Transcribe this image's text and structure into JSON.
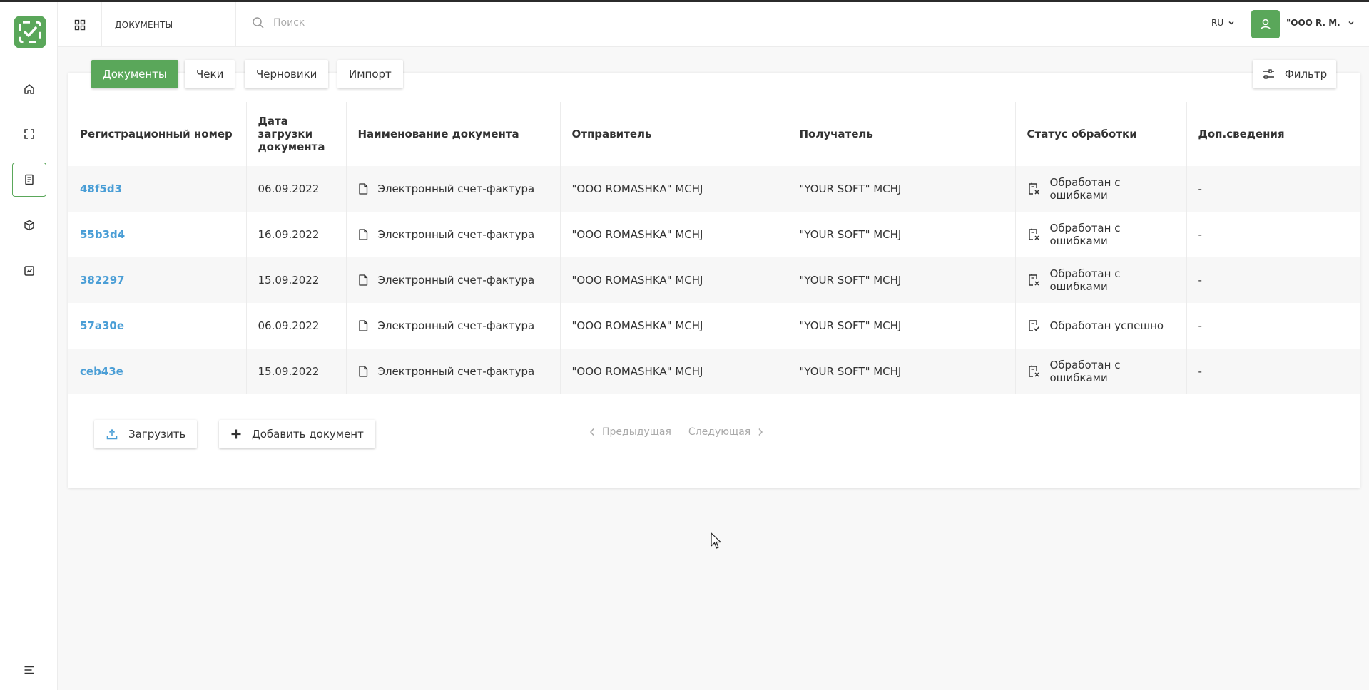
{
  "topbar": {
    "section_title": "ДОКУМЕНТЫ",
    "search_placeholder": "Поиск",
    "lang": "RU",
    "user_name": "\"OOO R. M."
  },
  "tabs": [
    {
      "label": "Документы",
      "active": true
    },
    {
      "label": "Чеки",
      "active": false
    },
    {
      "label": "Черновики",
      "active": false
    },
    {
      "label": "Импорт",
      "active": false
    }
  ],
  "filter_label": "Фильтр",
  "table": {
    "headers": {
      "reg": "Регистрационный номер",
      "date": "Дата загрузки документа",
      "name": "Наименование документа",
      "sender": "Отправитель",
      "recipient": "Получатель",
      "status": "Статус обработки",
      "extra": "Доп.сведения"
    },
    "rows": [
      {
        "reg": "48f5d3",
        "date": "06.09.2022",
        "name": "Электронный счет-фактура",
        "sender": "\"OOO ROMASHKA\" MCHJ",
        "recipient": "\"YOUR SOFT\" MCHJ",
        "status": "Обработан с ошибками",
        "status_icon": "doc-error-icon",
        "extra": "-"
      },
      {
        "reg": "55b3d4",
        "date": "16.09.2022",
        "name": "Электронный счет-фактура",
        "sender": "\"OOO ROMASHKA\" MCHJ",
        "recipient": "\"YOUR SOFT\" MCHJ",
        "status": "Обработан с ошибками",
        "status_icon": "doc-error-icon",
        "extra": "-"
      },
      {
        "reg": "382297",
        "date": "15.09.2022",
        "name": "Электронный счет-фактура",
        "sender": "\"OOO ROMASHKA\" MCHJ",
        "recipient": "\"YOUR SOFT\" MCHJ",
        "status": "Обработан с ошибками",
        "status_icon": "doc-error-icon",
        "extra": "-"
      },
      {
        "reg": "57a30e",
        "date": "06.09.2022",
        "name": "Электронный счет-фактура",
        "sender": "\"OOO ROMASHKA\" MCHJ",
        "recipient": "\"YOUR SOFT\" MCHJ",
        "status": "Обработан успешно",
        "status_icon": "doc-success-icon",
        "extra": "-"
      },
      {
        "reg": "ceb43e",
        "date": "15.09.2022",
        "name": "Электронный счет-фактура",
        "sender": "\"OOO ROMASHKA\" MCHJ",
        "recipient": "\"YOUR SOFT\" MCHJ",
        "status": "Обработан с ошибками",
        "status_icon": "doc-error-icon",
        "extra": "-"
      }
    ]
  },
  "actions": {
    "upload": "Загрузить",
    "add_document": "Добавить документ"
  },
  "pager": {
    "prev": "Предыдущая",
    "next": "Следующая"
  },
  "colors": {
    "accent": "#5aa75a",
    "link": "#4a9ed6"
  }
}
